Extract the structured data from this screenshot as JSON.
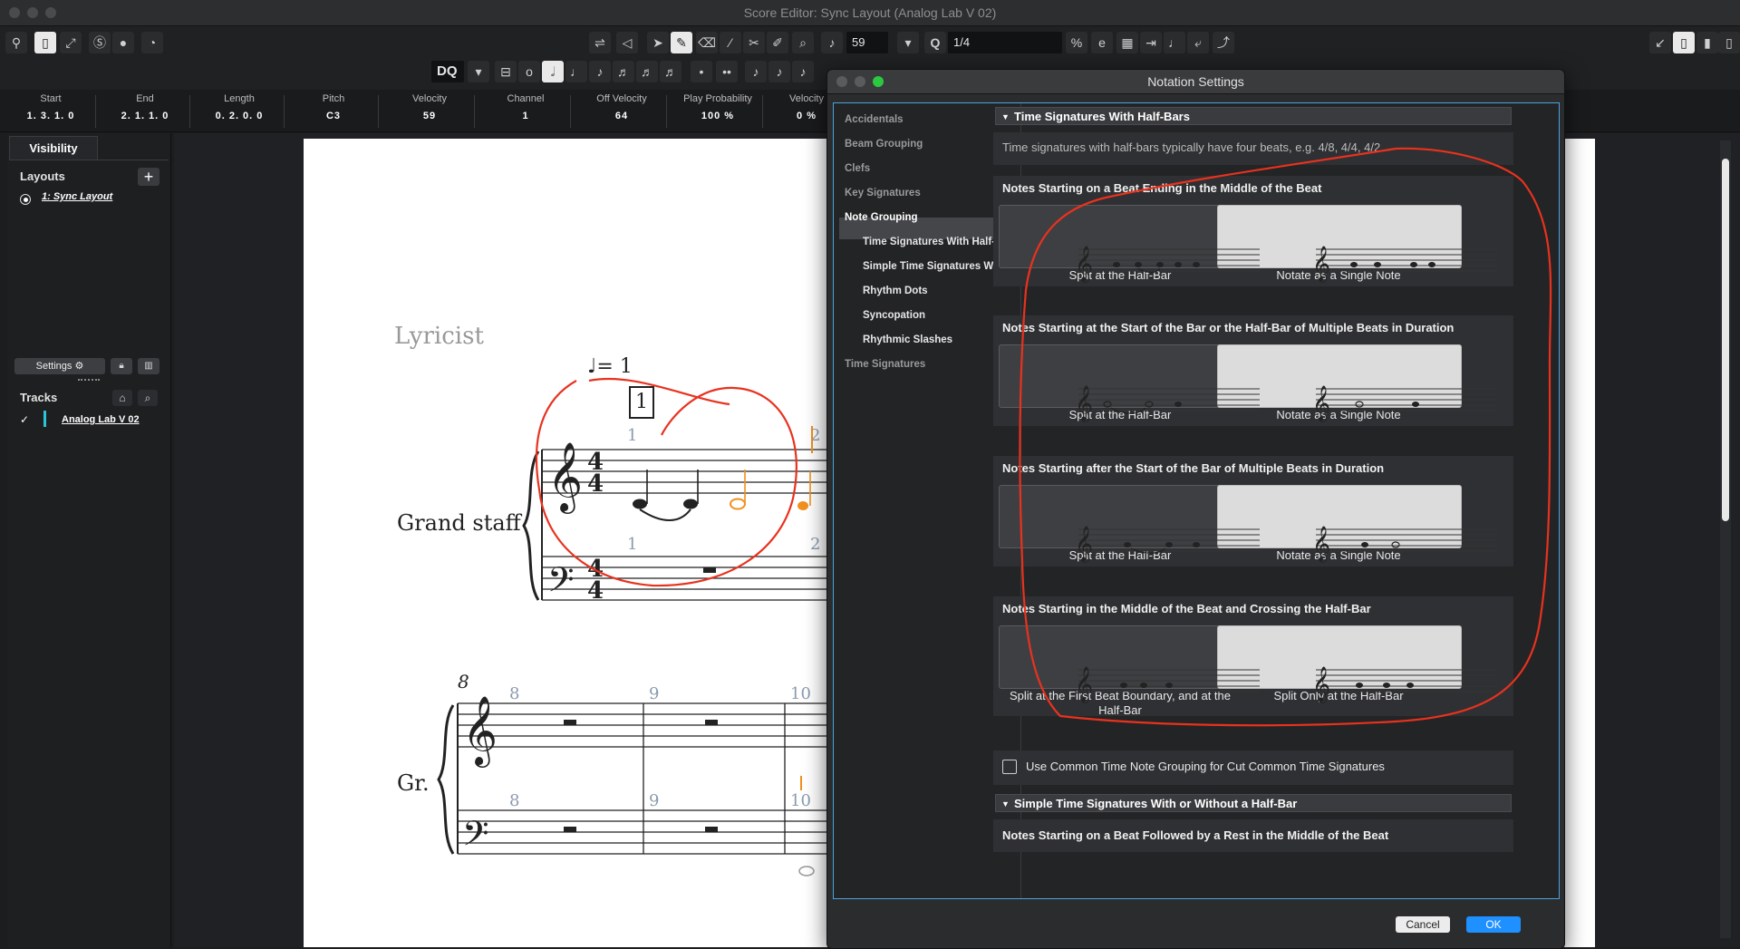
{
  "window": {
    "title": "Score Editor: Sync Layout (Analog Lab V 02)"
  },
  "toolbar": {
    "velocity_value": "59",
    "quantize_label": "Q",
    "quantize_value": "1/4",
    "dq_label": "DQ"
  },
  "info_line": [
    {
      "header": "Start",
      "value": "1. 3. 1.  0"
    },
    {
      "header": "End",
      "value": "2. 1. 1.  0"
    },
    {
      "header": "Length",
      "value": "0. 2. 0.  0"
    },
    {
      "header": "Pitch",
      "value": "C3"
    },
    {
      "header": "Velocity",
      "value": "59"
    },
    {
      "header": "Channel",
      "value": "1"
    },
    {
      "header": "Off Velocity",
      "value": "64"
    },
    {
      "header": "Play Probability",
      "value": "100 %"
    },
    {
      "header": "Velocity",
      "value": "0 %"
    }
  ],
  "left_pane": {
    "tab": "Visibility",
    "layouts_title": "Layouts",
    "layout_item": "1: Sync Layout",
    "settings_button": "Settings",
    "tracks_title": "Tracks",
    "track_item": "Analog Lab V 02",
    "track_check": "✓"
  },
  "score": {
    "lyricist": "Lyricist",
    "tempo": "= 1",
    "rehearsal_mark": "1",
    "staff_name": "Grand staff",
    "staff_short": "Gr.",
    "bar_numbers_top": [
      "1",
      "2"
    ],
    "bar_numbers_bottom": [
      "1",
      "2"
    ],
    "system2_number": "8",
    "system2_bars": [
      "8",
      "9",
      "10"
    ]
  },
  "dialog": {
    "title": "Notation Settings",
    "nav": [
      {
        "label": "Accidentals",
        "sub": false
      },
      {
        "label": "Beam Grouping",
        "sub": false
      },
      {
        "label": "Clefs",
        "sub": false
      },
      {
        "label": "Key Signatures",
        "sub": false
      },
      {
        "label": "Note Grouping",
        "sub": false,
        "selected": true
      },
      {
        "label": "Time Signatures With Half-Ba",
        "sub": true
      },
      {
        "label": "Simple Time Signatures With",
        "sub": true
      },
      {
        "label": "Rhythm Dots",
        "sub": true
      },
      {
        "label": "Syncopation",
        "sub": true
      },
      {
        "label": "Rhythmic Slashes",
        "sub": true
      },
      {
        "label": "Time Signatures",
        "sub": false
      }
    ],
    "section1": "Time Signatures With Half-Bars",
    "section1_desc": "Time signatures with half-bars typically have four beats, e.g. 4/8, 4/4, 4/2.",
    "groups": [
      {
        "title": "Notes Starting on a Beat Ending in the Middle of the Beat",
        "left": "Split at the Half-Bar",
        "right": "Notate as a Single Note",
        "selected": "right"
      },
      {
        "title": "Notes Starting at the Start of the Bar or the Half-Bar of Multiple Beats in Duration",
        "left": "Split at the Half-Bar",
        "right": "Notate as a Single Note",
        "selected": "right"
      },
      {
        "title": "Notes Starting after the Start of the Bar of Multiple Beats in Duration",
        "left": "Split at the Half-Bar",
        "right": "Notate as a Single Note",
        "selected": "right"
      },
      {
        "title": "Notes Starting in the Middle of the Beat and Crossing the Half-Bar",
        "left": "Split at the First Beat Boundary, and at the Half-Bar",
        "right": "Split Only at the Half-Bar",
        "selected": "right"
      }
    ],
    "checkbox_label": "Use Common Time Note Grouping for Cut Common Time Signatures",
    "section2": "Simple Time Signatures With or Without a Half-Bar",
    "section2_group": "Notes Starting on a Beat Followed by a Rest in the Middle of the Beat",
    "cancel": "Cancel",
    "ok": "OK"
  },
  "colors": {
    "accent": "#1e90ff",
    "annotation": "#e8321e",
    "selection": "#f0901e"
  }
}
